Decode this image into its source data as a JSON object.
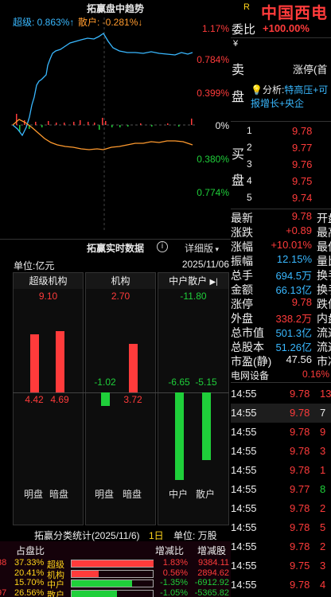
{
  "trend": {
    "title": "拓赢盘中趋势",
    "super_label": "超级: 0.863%↑",
    "retail_label": "散户: -0.281%↓",
    "axis_labels": [
      "1.17%",
      "0.784%",
      "0.399%",
      "0%",
      "0.380%",
      "0.774%"
    ]
  },
  "realtime": {
    "title": "拓赢实时数据",
    "info_icon": "info-icon",
    "detail": "详细版",
    "unit": "单位:亿元",
    "date": "2025/11/06",
    "columns": [
      {
        "name": "超级机构",
        "value": "9.10",
        "value_color": "red",
        "bars": [
          {
            "label": "4.42",
            "value": 4.42,
            "color": "red",
            "dir": "up"
          },
          {
            "label": "4.69",
            "value": 4.69,
            "color": "red",
            "dir": "up"
          }
        ],
        "foot": [
          "明盘",
          "暗盘"
        ]
      },
      {
        "name": "机构",
        "value": "2.70",
        "value_color": "red",
        "bars": [
          {
            "label": "-1.02",
            "value": -1.02,
            "color": "green",
            "dir": "down"
          },
          {
            "label": "3.72",
            "value": 3.72,
            "color": "red",
            "dir": "up"
          }
        ],
        "foot": [
          "明盘",
          "暗盘"
        ]
      },
      {
        "name": "中户散户",
        "value": "-11.80",
        "value_color": "green",
        "bars": [
          {
            "label": "-6.65",
            "value": -6.65,
            "color": "green",
            "dir": "down"
          },
          {
            "label": "-5.15",
            "value": -5.15,
            "color": "green",
            "dir": "down"
          }
        ],
        "foot": [
          "中户",
          "散户"
        ]
      }
    ]
  },
  "stats": {
    "title": "拓赢分类统计(2025/11/6)",
    "period": "1日",
    "unit": "单位: 万股",
    "headers": [
      "占盘比",
      "增减比",
      "增减股"
    ],
    "rows": [
      {
        "edge": "38",
        "pct": "37.33%",
        "name": "超级",
        "ratio": "1.83%",
        "shares": "9384.11",
        "fill": 1.0,
        "color": "red"
      },
      {
        "edge": "",
        "pct": "20.41%",
        "name": "机构",
        "ratio": "0.56%",
        "shares": "2894.62",
        "fill": 0.33,
        "color": "red"
      },
      {
        "edge": "",
        "pct": "15.70%",
        "name": "中户",
        "ratio": "-1.35%",
        "shares": "-6912.92",
        "fill": 0.74,
        "color": "green"
      },
      {
        "edge": "97",
        "pct": "26.56%",
        "name": "散户",
        "ratio": "-1.05%",
        "shares": "-5365.82",
        "fill": 0.55,
        "color": "green"
      }
    ]
  },
  "right": {
    "r_mark": "R",
    "stock_name": "中国西电",
    "weibi_label": "委比",
    "weibi": "+100.00%",
    "yen": "¥",
    "sell_label": [
      "卖",
      "盘"
    ],
    "limit_label": "涨停(首",
    "analysis_prefix": "分析:",
    "analysis_text": "特高压+可",
    "analysis_text2": "报增长+央企",
    "buy_label": [
      "买",
      "盘"
    ],
    "buy_rows": [
      {
        "n": "1",
        "price": "9.78"
      },
      {
        "n": "2",
        "price": "9.77"
      },
      {
        "n": "3",
        "price": "9.76"
      },
      {
        "n": "4",
        "price": "9.75"
      },
      {
        "n": "5",
        "price": "9.74"
      }
    ],
    "quotes": [
      {
        "k": "最新",
        "v": "9.78",
        "extra": "开盘",
        "vc": "red"
      },
      {
        "k": "涨跌",
        "v": "+0.89",
        "extra": "最高",
        "vc": "red"
      },
      {
        "k": "涨幅",
        "v": "+10.01%",
        "extra": "最低",
        "vc": "red"
      },
      {
        "k": "振幅",
        "v": "12.15%",
        "extra": "量比",
        "vc": "cyan"
      },
      {
        "k": "总手",
        "v": "694.5万",
        "extra": "换手",
        "vc": "cyan"
      },
      {
        "k": "金额",
        "v": "66.13亿",
        "extra": "换手",
        "vc": "cyan"
      },
      {
        "k": "涨停",
        "v": "9.78",
        "extra": "跌停",
        "vc": "red"
      },
      {
        "k": "外盘",
        "v": "338.2万",
        "extra": "内盘",
        "vc": "red"
      },
      {
        "k": "总市值",
        "v": "501.3亿",
        "extra": "流通",
        "vc": "cyan"
      },
      {
        "k": "总股本",
        "v": "51.26亿",
        "extra": "流通",
        "vc": "cyan"
      },
      {
        "k": "市盈(静)",
        "v": "47.56",
        "extra": "市净",
        "vc": "white"
      }
    ],
    "sector": {
      "name": "电网设备",
      "pct": "0.16%"
    },
    "trades": [
      {
        "time": "14:55",
        "price": "9.78",
        "vol": "13",
        "vc": "red"
      },
      {
        "time": "14:55",
        "price": "9.78",
        "vol": "7",
        "vc": "white"
      },
      {
        "time": "14:55",
        "price": "9.78",
        "vol": "9",
        "vc": "red"
      },
      {
        "time": "14:55",
        "price": "9.78",
        "vol": "3",
        "vc": "red"
      },
      {
        "time": "14:55",
        "price": "9.78",
        "vol": "1",
        "vc": "red"
      },
      {
        "time": "14:55",
        "price": "9.77",
        "vol": "8",
        "vc": "green"
      },
      {
        "time": "14:55",
        "price": "9.78",
        "vol": "2",
        "vc": "red"
      },
      {
        "time": "14:55",
        "price": "9.78",
        "vol": "5",
        "vc": "red"
      },
      {
        "time": "14:55",
        "price": "9.78",
        "vol": "2",
        "vc": "red"
      },
      {
        "time": "14:55",
        "price": "9.75",
        "vol": "3",
        "vc": "red"
      },
      {
        "time": "14:55",
        "price": "9.78",
        "vol": "4",
        "vc": "red"
      }
    ]
  }
}
